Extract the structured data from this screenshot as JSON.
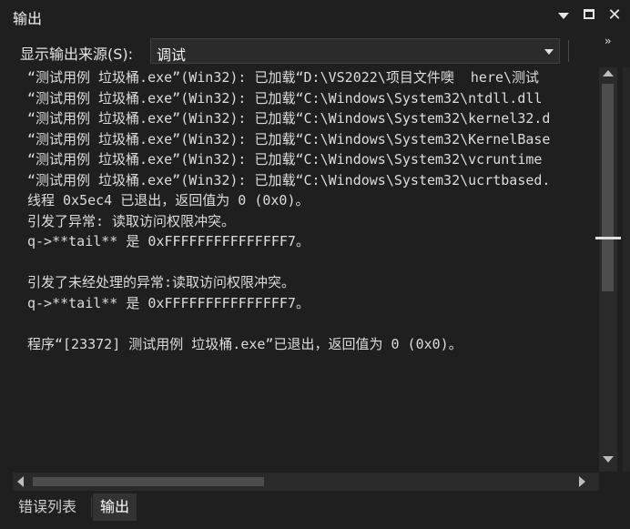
{
  "window": {
    "title": "输出"
  },
  "toolbar": {
    "source_label": "显示输出来源(S):",
    "source_value": "调试"
  },
  "output": {
    "lines": [
      "“测试用例 垃圾桶.exe”(Win32): 已加载“D:\\VS2022\\项目文件噢  here\\测试",
      "“测试用例 垃圾桶.exe”(Win32): 已加载“C:\\Windows\\System32\\ntdll.dll",
      "“测试用例 垃圾桶.exe”(Win32): 已加载“C:\\Windows\\System32\\kernel32.d",
      "“测试用例 垃圾桶.exe”(Win32): 已加载“C:\\Windows\\System32\\KernelBase",
      "“测试用例 垃圾桶.exe”(Win32): 已加载“C:\\Windows\\System32\\vcruntime",
      "“测试用例 垃圾桶.exe”(Win32): 已加载“C:\\Windows\\System32\\ucrtbased.",
      "线程 0x5ec4 已退出，返回值为 0 (0x0)。",
      "引发了异常: 读取访问权限冲突。",
      "q->**tail** 是 0xFFFFFFFFFFFFFFF7。",
      "",
      "引发了未经处理的异常:读取访问权限冲突。",
      "q->**tail** 是 0xFFFFFFFFFFFFFFF7。",
      "",
      "程序“[23372] 测试用例 垃圾桶.exe”已退出，返回值为 0 (0x0)。"
    ]
  },
  "tabs": [
    {
      "label": "错误列表",
      "active": false
    },
    {
      "label": "输出",
      "active": true
    }
  ],
  "icons": {
    "dropdown": "chevron-down-icon",
    "maximize": "maximize-icon",
    "close": "close-icon"
  }
}
